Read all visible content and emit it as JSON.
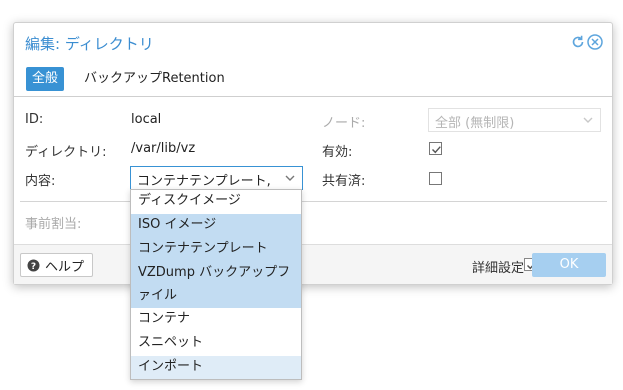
{
  "dialog": {
    "title": "編集: ディレクトリ",
    "tabs": {
      "general": "全般",
      "retention": "バックアップRetention"
    },
    "fields": {
      "id_label": "ID:",
      "id_value": "local",
      "node_label": "ノード:",
      "node_value": "全部 (無制限)",
      "dir_label": "ディレクトリ:",
      "dir_value": "/var/lib/vz",
      "enabled_label": "有効:",
      "content_label": "内容:",
      "content_value": "コンテナテンプレート,",
      "shared_label": "共有済:",
      "prealloc_label": "事前割当:"
    },
    "checkboxes": {
      "enabled": true,
      "shared": false,
      "advanced": true
    },
    "footer": {
      "help": "ヘルプ",
      "advanced": "詳細設定",
      "ok": "OK"
    }
  },
  "dropdown": {
    "items": [
      {
        "label": "ディスクイメージ",
        "selected": false
      },
      {
        "label": "ISO イメージ",
        "selected": true
      },
      {
        "label": "コンテナテンプレート",
        "selected": true
      },
      {
        "label": "VZDump バックアップファイル",
        "selected": true
      },
      {
        "label": "コンテナ",
        "selected": false
      },
      {
        "label": "スニペット",
        "selected": false
      },
      {
        "label": "インポート",
        "selected": false
      }
    ]
  },
  "colors": {
    "accent": "#3892d4",
    "selected": "#c2dcf2",
    "ok_disabled": "#a6cff0",
    "title": "#3b8dd1"
  },
  "icons": {
    "refresh": "refresh-icon",
    "close": "close-circle-icon",
    "help": "question-circle-icon",
    "dropdown": "chevron-down-icon"
  }
}
